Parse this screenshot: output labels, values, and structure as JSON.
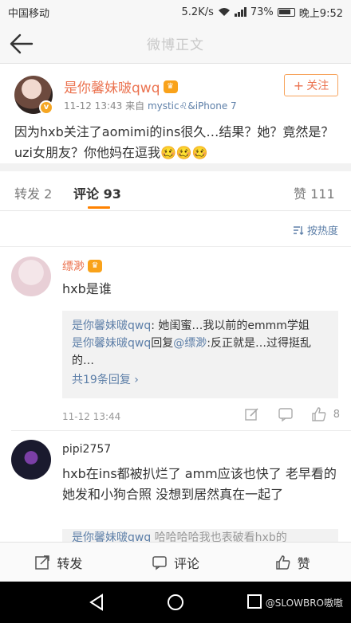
{
  "status_bar": {
    "carrier": "中国移动",
    "speed": "5.2K/s",
    "battery": "73%",
    "time": "晚上9:52"
  },
  "nav": {
    "title": "微博正文"
  },
  "post": {
    "author": "是你馨妹啵qwq",
    "time": "11-12 13:43",
    "source_prefix": "来自",
    "source": "mystic♌&iPhone 7",
    "follow_label": "关注",
    "content": "因为hxb关注了aomimi的ins很久…结果？她？竟然是？uzi女朋友？你他妈在逗我🥴🥴🥴"
  },
  "tabs": {
    "repost": "转发 2",
    "comment": "评论 93",
    "like": "赞 111"
  },
  "sort_label": "按热度",
  "comments": [
    {
      "name": "缥渺",
      "text": "hxb是谁",
      "replies": [
        {
          "user": "是你馨妹啵qwq",
          "sep": ": ",
          "text": "她闺蜜…我以前的emmm学姐"
        },
        {
          "user": "是你馨妹啵qwq",
          "mid": "回复",
          "mention": "@缥渺",
          "sep": ":",
          "text": "反正就是…过得挺乱的…"
        }
      ],
      "more": "共19条回复 ",
      "time": "11-12 13:44",
      "likes": "8"
    },
    {
      "name": "pipi2757",
      "text": "hxb在ins都被扒烂了 amm应该也快了 老早看的她发和小狗合照 没想到居然真在一起了",
      "partial_reply_user": "是你馨妹啵qwq",
      "partial_reply_text": "哈哈哈哈我也表破看hxb的"
    }
  ],
  "bottom_bar": {
    "repost": "转发",
    "comment": "评论",
    "like": "赞"
  },
  "watermark": "@SLOWBRO嗷嗷",
  "colors": {
    "accent": "#eb7350",
    "link": "#5d7fa8",
    "tab_indicator": "#ff8200"
  }
}
